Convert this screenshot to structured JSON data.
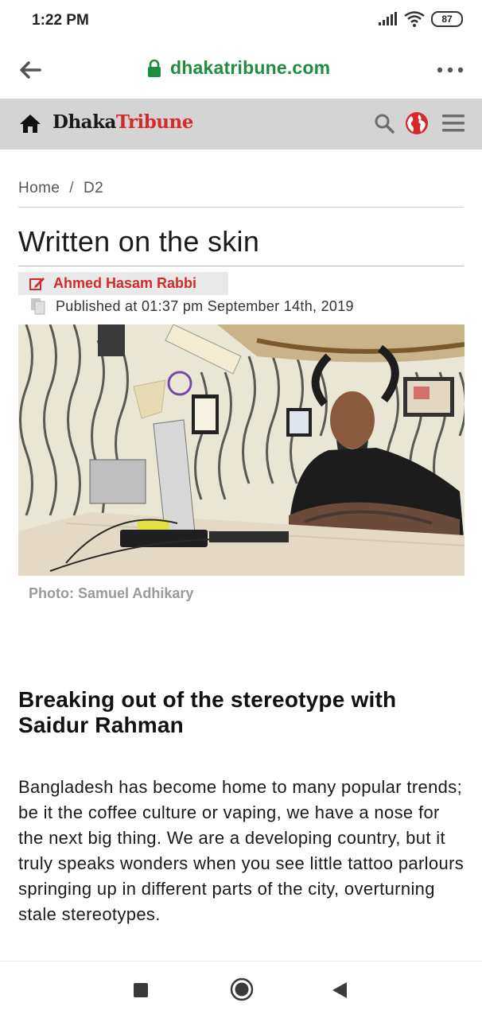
{
  "status_bar": {
    "time": "1:22 PM",
    "battery": "87"
  },
  "browser": {
    "url": "dhakatribune.com"
  },
  "site": {
    "brand_part1": "Dhaka",
    "brand_part2": "Tribune",
    "brand_color": "#d42a2a",
    "icons": [
      "home-icon",
      "search-icon",
      "globe-icon",
      "menu-icon"
    ]
  },
  "breadcrumb": {
    "items": [
      "Home",
      "D2"
    ],
    "separator": "/"
  },
  "article": {
    "title": "Written on the skin",
    "author": "Ahmed Hasam Rabbi",
    "published": "Published at 01:37 pm September 14th, 2019",
    "photo_caption": "Photo: Samuel Adhikary",
    "subhead": "Breaking out of the stereotype with Saidur Rahman",
    "body": "Bangladesh has become home to many popular trends; be it the coffee culture or vaping, we have a nose for the next big thing. We are a developing country, but it truly speaks wonders when you see little tattoo parlours springing up in different parts of the city, overturning stale stereotypes."
  },
  "colors": {
    "url_green": "#1e8e3e",
    "header_bg": "#d4d4d4",
    "accent_red": "#d42a2a"
  }
}
